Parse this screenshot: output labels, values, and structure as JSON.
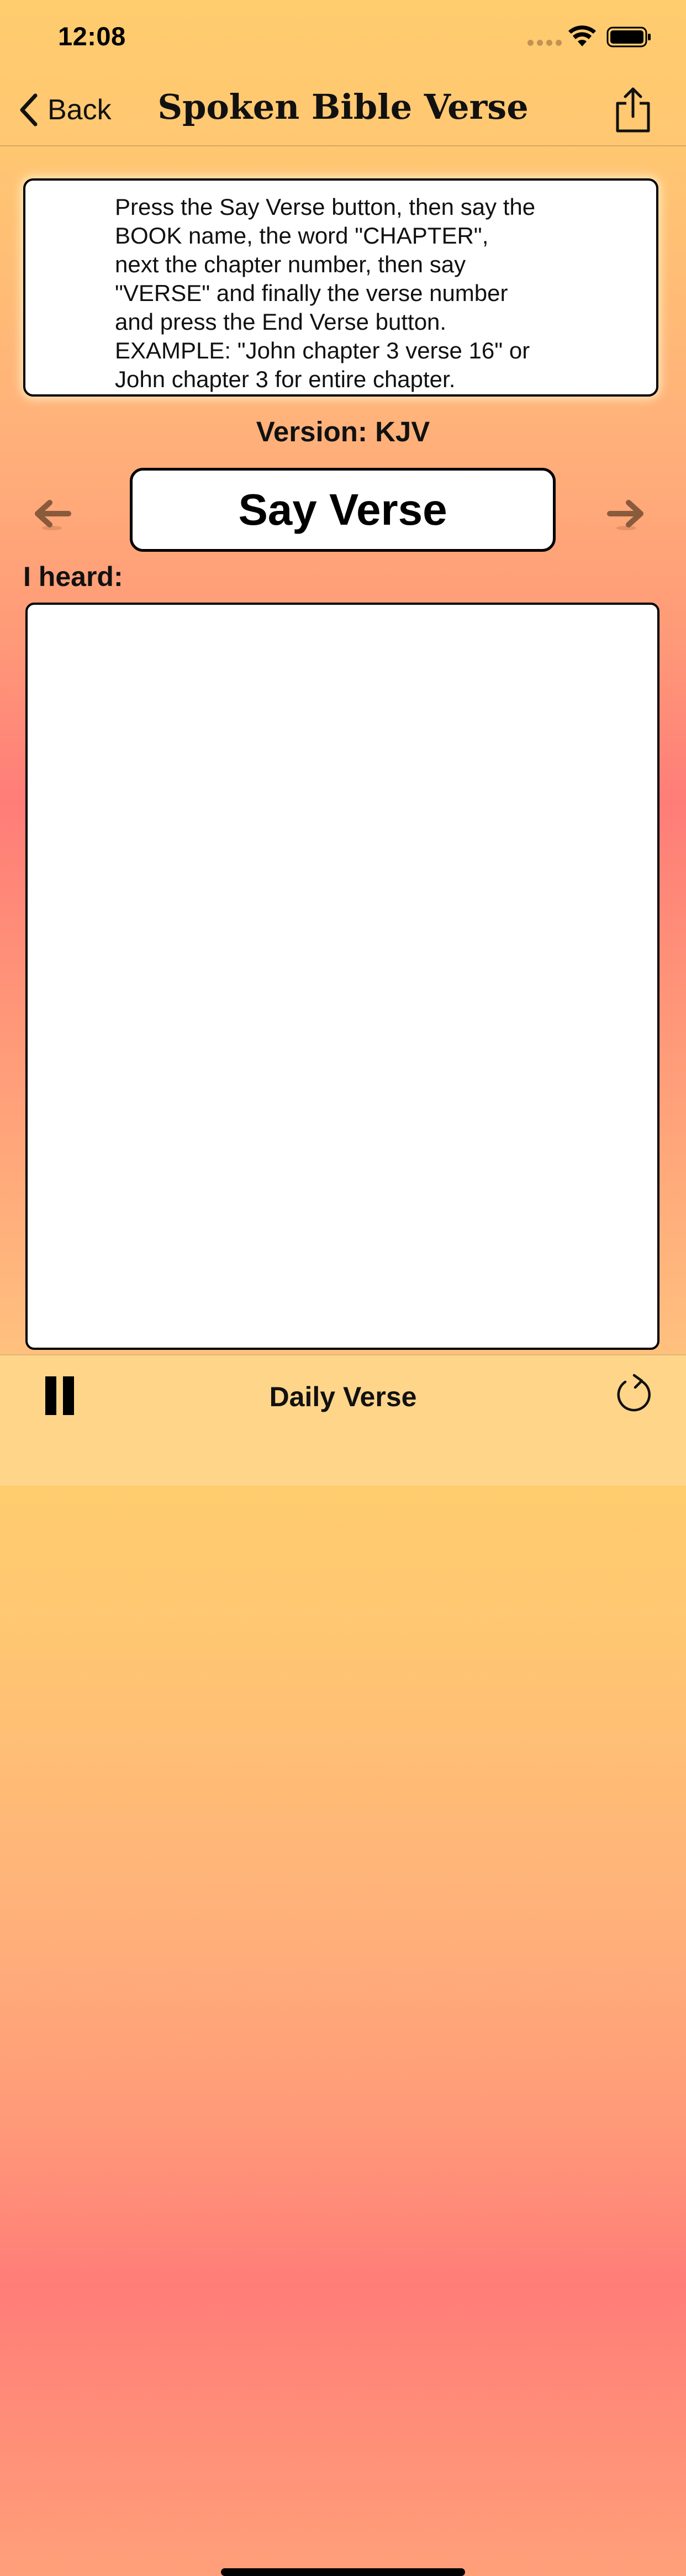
{
  "status_bar": {
    "time": "12:08"
  },
  "nav": {
    "back_label": "Back",
    "title": "Spoken Bible Verse"
  },
  "instructions": {
    "lines": [
      "Press the Say Verse button, then say the",
      "BOOK name, the word \"CHAPTER\",",
      "next the chapter number, then say",
      "\"VERSE\" and finally the verse number",
      "and press the End Verse button.",
      "EXAMPLE: \"John chapter 3 verse 16\" or",
      "John chapter 3 for entire chapter."
    ]
  },
  "version_label": "Version: KJV",
  "say_verse_label": "Say Verse",
  "heard_label": "I heard:",
  "heard_text": "",
  "toolbar": {
    "daily_verse_label": "Daily Verse"
  },
  "colors": {
    "arrow": "#8a5a3c",
    "toolbar_bg": "#ffd58a"
  }
}
